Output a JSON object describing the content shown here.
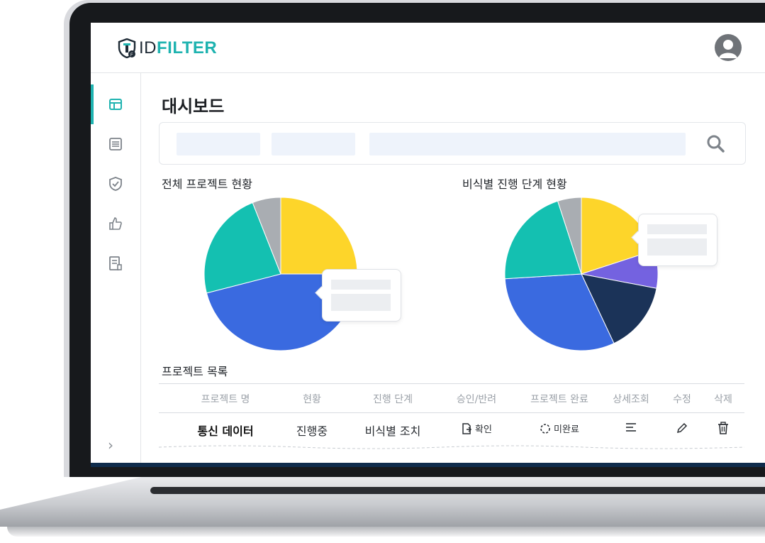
{
  "brand": {
    "id_text": "ID",
    "filter_text": "FILTER",
    "accent": "#1fb3b0"
  },
  "page": {
    "title": "대시보드"
  },
  "charts": {
    "left_title": "전체 프로젝트 현황",
    "right_title": "비식별 진행 단계 현황"
  },
  "chart_data": [
    {
      "type": "pie",
      "title": "전체 프로젝트 현황",
      "values": [
        25,
        46,
        23,
        6
      ],
      "colors": [
        "#fdd52a",
        "#3a6ae0",
        "#14c0b1",
        "#a9adb2"
      ]
    },
    {
      "type": "pie",
      "title": "비식별 진행 단계 현황",
      "values": [
        20,
        8,
        15,
        31,
        21,
        5
      ],
      "colors": [
        "#fdd52a",
        "#7462e0",
        "#1b3358",
        "#3a6ae0",
        "#14c0b1",
        "#a9adb2"
      ]
    }
  ],
  "table": {
    "title": "프로젝트 목록",
    "headers": [
      "프로젝트 명",
      "현황",
      "진행 단계",
      "승인/반려",
      "프로젝트 완료",
      "상세조회",
      "수정",
      "삭제"
    ],
    "row": {
      "name": "통신 데이터",
      "status": "진행중",
      "stage": "비식별 조치",
      "approval": "확인",
      "completion": "미완료"
    }
  }
}
